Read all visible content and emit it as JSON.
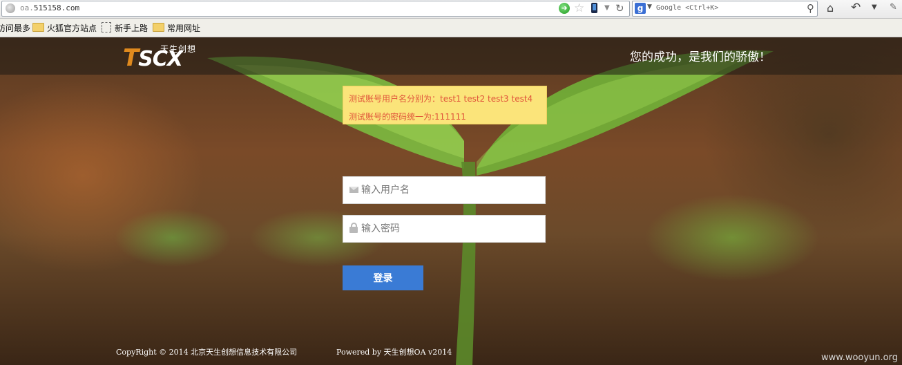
{
  "browser": {
    "url_host_prefix": "oa.",
    "url_host_rest": "515158.com",
    "search_placeholder": "Google <Ctrl+K>",
    "search_engine_letter": "g"
  },
  "bookmarks": [
    {
      "label": "访问最多",
      "icon": "none"
    },
    {
      "label": "火狐官方站点",
      "icon": "folder-icon"
    },
    {
      "label": "新手上路",
      "icon": "page-icon"
    },
    {
      "label": "常用网址",
      "icon": "folder-icon"
    }
  ],
  "header": {
    "logo_text": "TSCX",
    "logo_cn": "天生创想",
    "slogan": "您的成功，是我们的骄傲！"
  },
  "notice": {
    "line1": "测试账号用户名分别为：test1  test2  test3  test4",
    "line2": "测试账号的密码统一为:111111"
  },
  "login": {
    "username_placeholder": "输入用户名",
    "password_placeholder": "输入密码",
    "submit_label": "登录"
  },
  "footer": {
    "copyright": "CopyRight © 2014  北京天生创想信息技术有限公司",
    "powered": "Powered by 天生创想OA v2014"
  },
  "watermark": "www.wooyun.org",
  "colors": {
    "accent_button": "#3a7bd5",
    "notice_bg": "#fbe47a",
    "notice_text": "#e0543a",
    "logo_orange": "#e08a1e"
  }
}
